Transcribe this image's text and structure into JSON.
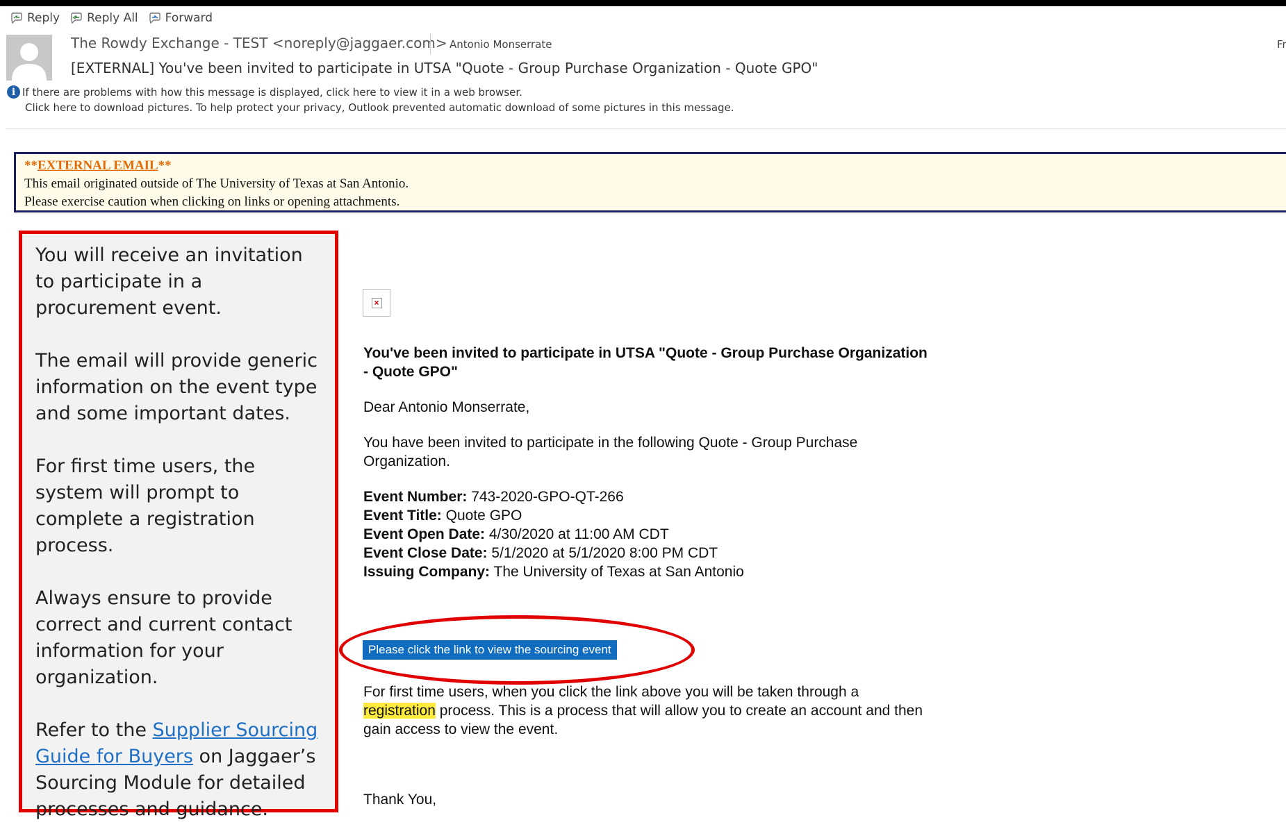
{
  "toolbar": {
    "reply": "Reply",
    "reply_all": "Reply All",
    "forward": "Forward"
  },
  "header": {
    "from": "The Rowdy Exchange - TEST <noreply@jaggaer.com>",
    "to": "Antonio Monserrate",
    "date_partial": "Fr",
    "subject": "[EXTERNAL] You've been invited to participate in UTSA \"Quote - Group Purchase Organization - Quote GPO\"",
    "info_notice": "If there are problems with how this message is displayed, click here to view it in a web browser.",
    "download_notice": "Click here to download pictures. To help protect your privacy, Outlook prevented automatic download of some pictures in this message."
  },
  "external_banner": {
    "prefix": "**",
    "label": "EXTERNAL EMAIL",
    "suffix": "**",
    "line1": "This email originated outside of The University of Texas at San Antonio.",
    "line2": "Please exercise caution when clicking on links or opening attachments."
  },
  "callout": {
    "p1": "You will receive an invitation to participate in a procurement event.",
    "p2": "The email will provide generic information on the event type and some important dates.",
    "p3": "For first time users, the system will prompt to complete a registration process.",
    "p4": "Always ensure to provide correct  and current contact information for your organization.",
    "p5_before": "Refer to the ",
    "p5_link": "Supplier Sourcing Guide for Buyers",
    "p5_after": " on Jaggaer’s Sourcing Module for detailed processes and guidance."
  },
  "email_body": {
    "title": "You've been invited to participate in UTSA \"Quote - Group Purchase Organization - Quote GPO\"",
    "greeting": "Dear Antonio Monserrate,",
    "intro": "You have been invited to participate in the following Quote - Group Purchase Organization.",
    "details": [
      {
        "label": "Event Number:",
        "value": " 743-2020-GPO-QT-266"
      },
      {
        "label": "Event Title:",
        "value": " Quote GPO"
      },
      {
        "label": "Event Open Date:",
        "value": " 4/30/2020 at 11:00 AM CDT"
      },
      {
        "label": "Event Close Date:",
        "value": " 5/1/2020 at 5/1/2020 8:00 PM CDT"
      },
      {
        "label": "Issuing Company:",
        "value": " The University of Texas at San Antonio"
      }
    ],
    "cta": "Please click the link to view the sourcing event",
    "after_before": "For first time users, when you click the link above you will be taken through a ",
    "after_highlight": "registration",
    "after_after": " process. This is a process that will allow you to create an account and then gain access to view the event.",
    "thanks": "Thank You,"
  }
}
